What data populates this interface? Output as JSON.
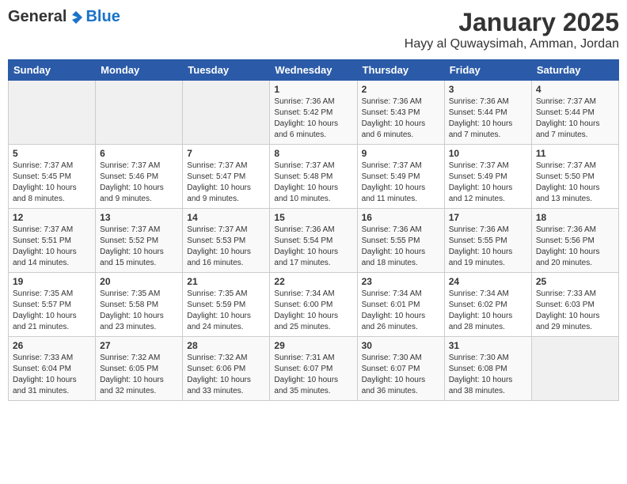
{
  "header": {
    "logo": {
      "general": "General",
      "blue": "Blue"
    },
    "title": "January 2025",
    "subtitle": "Hayy al Quwaysimah, Amman, Jordan"
  },
  "weekdays": [
    "Sunday",
    "Monday",
    "Tuesday",
    "Wednesday",
    "Thursday",
    "Friday",
    "Saturday"
  ],
  "weeks": [
    [
      {
        "day": "",
        "sunrise": "",
        "sunset": "",
        "daylight": ""
      },
      {
        "day": "",
        "sunrise": "",
        "sunset": "",
        "daylight": ""
      },
      {
        "day": "",
        "sunrise": "",
        "sunset": "",
        "daylight": ""
      },
      {
        "day": "1",
        "sunrise": "Sunrise: 7:36 AM",
        "sunset": "Sunset: 5:42 PM",
        "daylight": "Daylight: 10 hours and 6 minutes."
      },
      {
        "day": "2",
        "sunrise": "Sunrise: 7:36 AM",
        "sunset": "Sunset: 5:43 PM",
        "daylight": "Daylight: 10 hours and 6 minutes."
      },
      {
        "day": "3",
        "sunrise": "Sunrise: 7:36 AM",
        "sunset": "Sunset: 5:44 PM",
        "daylight": "Daylight: 10 hours and 7 minutes."
      },
      {
        "day": "4",
        "sunrise": "Sunrise: 7:37 AM",
        "sunset": "Sunset: 5:44 PM",
        "daylight": "Daylight: 10 hours and 7 minutes."
      }
    ],
    [
      {
        "day": "5",
        "sunrise": "Sunrise: 7:37 AM",
        "sunset": "Sunset: 5:45 PM",
        "daylight": "Daylight: 10 hours and 8 minutes."
      },
      {
        "day": "6",
        "sunrise": "Sunrise: 7:37 AM",
        "sunset": "Sunset: 5:46 PM",
        "daylight": "Daylight: 10 hours and 9 minutes."
      },
      {
        "day": "7",
        "sunrise": "Sunrise: 7:37 AM",
        "sunset": "Sunset: 5:47 PM",
        "daylight": "Daylight: 10 hours and 9 minutes."
      },
      {
        "day": "8",
        "sunrise": "Sunrise: 7:37 AM",
        "sunset": "Sunset: 5:48 PM",
        "daylight": "Daylight: 10 hours and 10 minutes."
      },
      {
        "day": "9",
        "sunrise": "Sunrise: 7:37 AM",
        "sunset": "Sunset: 5:49 PM",
        "daylight": "Daylight: 10 hours and 11 minutes."
      },
      {
        "day": "10",
        "sunrise": "Sunrise: 7:37 AM",
        "sunset": "Sunset: 5:49 PM",
        "daylight": "Daylight: 10 hours and 12 minutes."
      },
      {
        "day": "11",
        "sunrise": "Sunrise: 7:37 AM",
        "sunset": "Sunset: 5:50 PM",
        "daylight": "Daylight: 10 hours and 13 minutes."
      }
    ],
    [
      {
        "day": "12",
        "sunrise": "Sunrise: 7:37 AM",
        "sunset": "Sunset: 5:51 PM",
        "daylight": "Daylight: 10 hours and 14 minutes."
      },
      {
        "day": "13",
        "sunrise": "Sunrise: 7:37 AM",
        "sunset": "Sunset: 5:52 PM",
        "daylight": "Daylight: 10 hours and 15 minutes."
      },
      {
        "day": "14",
        "sunrise": "Sunrise: 7:37 AM",
        "sunset": "Sunset: 5:53 PM",
        "daylight": "Daylight: 10 hours and 16 minutes."
      },
      {
        "day": "15",
        "sunrise": "Sunrise: 7:36 AM",
        "sunset": "Sunset: 5:54 PM",
        "daylight": "Daylight: 10 hours and 17 minutes."
      },
      {
        "day": "16",
        "sunrise": "Sunrise: 7:36 AM",
        "sunset": "Sunset: 5:55 PM",
        "daylight": "Daylight: 10 hours and 18 minutes."
      },
      {
        "day": "17",
        "sunrise": "Sunrise: 7:36 AM",
        "sunset": "Sunset: 5:55 PM",
        "daylight": "Daylight: 10 hours and 19 minutes."
      },
      {
        "day": "18",
        "sunrise": "Sunrise: 7:36 AM",
        "sunset": "Sunset: 5:56 PM",
        "daylight": "Daylight: 10 hours and 20 minutes."
      }
    ],
    [
      {
        "day": "19",
        "sunrise": "Sunrise: 7:35 AM",
        "sunset": "Sunset: 5:57 PM",
        "daylight": "Daylight: 10 hours and 21 minutes."
      },
      {
        "day": "20",
        "sunrise": "Sunrise: 7:35 AM",
        "sunset": "Sunset: 5:58 PM",
        "daylight": "Daylight: 10 hours and 23 minutes."
      },
      {
        "day": "21",
        "sunrise": "Sunrise: 7:35 AM",
        "sunset": "Sunset: 5:59 PM",
        "daylight": "Daylight: 10 hours and 24 minutes."
      },
      {
        "day": "22",
        "sunrise": "Sunrise: 7:34 AM",
        "sunset": "Sunset: 6:00 PM",
        "daylight": "Daylight: 10 hours and 25 minutes."
      },
      {
        "day": "23",
        "sunrise": "Sunrise: 7:34 AM",
        "sunset": "Sunset: 6:01 PM",
        "daylight": "Daylight: 10 hours and 26 minutes."
      },
      {
        "day": "24",
        "sunrise": "Sunrise: 7:34 AM",
        "sunset": "Sunset: 6:02 PM",
        "daylight": "Daylight: 10 hours and 28 minutes."
      },
      {
        "day": "25",
        "sunrise": "Sunrise: 7:33 AM",
        "sunset": "Sunset: 6:03 PM",
        "daylight": "Daylight: 10 hours and 29 minutes."
      }
    ],
    [
      {
        "day": "26",
        "sunrise": "Sunrise: 7:33 AM",
        "sunset": "Sunset: 6:04 PM",
        "daylight": "Daylight: 10 hours and 31 minutes."
      },
      {
        "day": "27",
        "sunrise": "Sunrise: 7:32 AM",
        "sunset": "Sunset: 6:05 PM",
        "daylight": "Daylight: 10 hours and 32 minutes."
      },
      {
        "day": "28",
        "sunrise": "Sunrise: 7:32 AM",
        "sunset": "Sunset: 6:06 PM",
        "daylight": "Daylight: 10 hours and 33 minutes."
      },
      {
        "day": "29",
        "sunrise": "Sunrise: 7:31 AM",
        "sunset": "Sunset: 6:07 PM",
        "daylight": "Daylight: 10 hours and 35 minutes."
      },
      {
        "day": "30",
        "sunrise": "Sunrise: 7:30 AM",
        "sunset": "Sunset: 6:07 PM",
        "daylight": "Daylight: 10 hours and 36 minutes."
      },
      {
        "day": "31",
        "sunrise": "Sunrise: 7:30 AM",
        "sunset": "Sunset: 6:08 PM",
        "daylight": "Daylight: 10 hours and 38 minutes."
      },
      {
        "day": "",
        "sunrise": "",
        "sunset": "",
        "daylight": ""
      }
    ]
  ]
}
